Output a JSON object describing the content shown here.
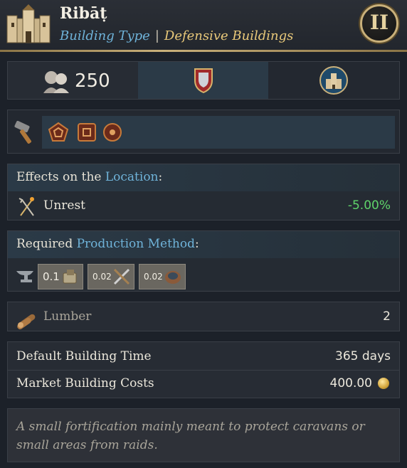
{
  "header": {
    "title": "Ribāṭ",
    "type_label": "Building Type",
    "type_value": "Defensive Buildings",
    "rank": "II"
  },
  "stats": {
    "population": "250"
  },
  "effects": {
    "heading_prefix": "Effects on the ",
    "heading_link": "Location",
    "heading_suffix": ":",
    "items": [
      {
        "label": "Unrest",
        "value": "-5.00%",
        "value_color": "#5fd46a"
      }
    ]
  },
  "production": {
    "heading_prefix": "Required ",
    "heading_link": "Production Method",
    "heading_suffix": ":",
    "goods": [
      {
        "qty": "0.1",
        "icon": "tools-goods-icon"
      },
      {
        "qty": "0.02",
        "icon": "weapons-goods-icon"
      },
      {
        "qty": "0.02",
        "icon": "pottery-goods-icon"
      }
    ]
  },
  "lumber": {
    "label": "Lumber",
    "value": "2"
  },
  "building": {
    "time_label": "Default Building Time",
    "time_value": "365 days",
    "cost_label": "Market Building Costs",
    "cost_value": "400.00"
  },
  "description": "A small fortification mainly meant to protect caravans or small areas from raids.",
  "colors": {
    "accent_blue": "#6fb3d9",
    "accent_gold": "#e9c97a",
    "positive": "#5fd46a"
  }
}
